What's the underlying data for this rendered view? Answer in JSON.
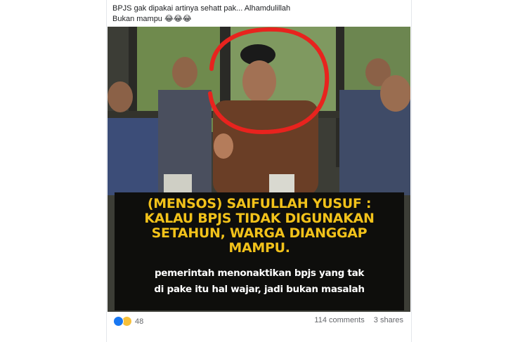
{
  "post": {
    "caption_line1": "BPJS gak dipakai artinya sehatt pak... Alhamdulillah",
    "caption_line2": "Bukan mampu 😂😂😂",
    "image": {
      "headline": [
        "(MENSOS) SAIFULLAH YUSUF :",
        "KALAU BPJS TIDAK DIGUNAKAN",
        "SETAHUN, WARGA DIANGGAP",
        "MAMPU."
      ],
      "subtext": [
        "pemerintah menonaktikan bpjs yang tak",
        "di pake itu hal wajar, jadi bukan masalah"
      ]
    },
    "footer": {
      "reaction_icons": [
        "like-icon",
        "haha-icon"
      ],
      "reaction_count": "48",
      "comments": "114 comments",
      "shares": "3 shares"
    }
  },
  "colors": {
    "headline": "#f2c21a",
    "subtext": "#ffffff",
    "overlay_bg": "#0e0e0c",
    "highlight_circle": "#e8231e",
    "like": "#1877f2",
    "haha": "#f7c03a"
  }
}
